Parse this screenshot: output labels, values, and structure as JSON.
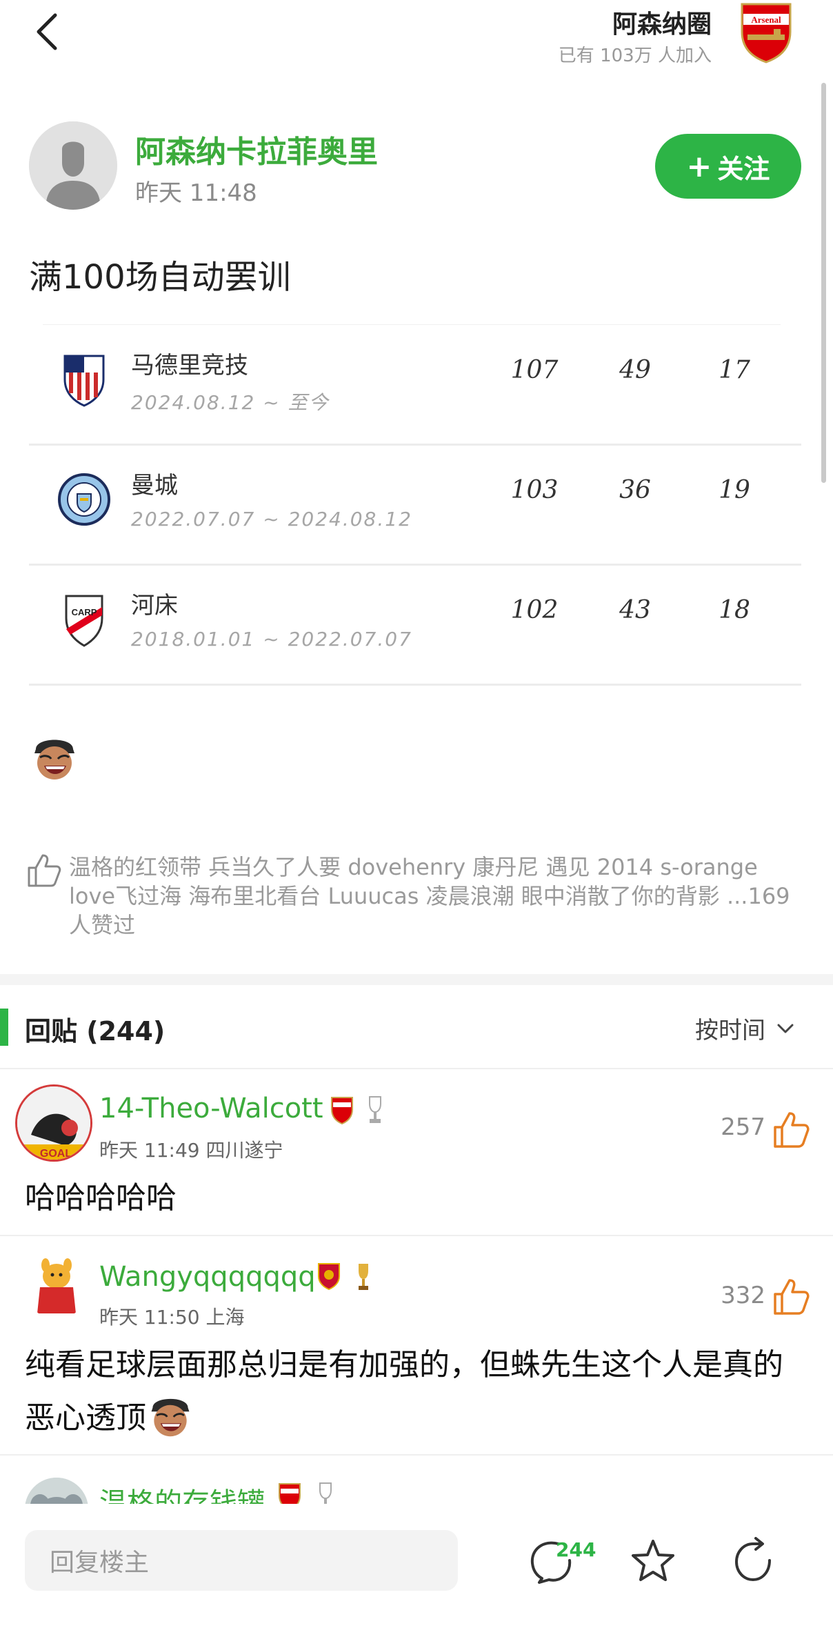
{
  "header": {
    "circle_name": "阿森纳圈",
    "members_prefix": "已有",
    "members_count": "103万",
    "members_suffix": "人加入",
    "logo_text": "Arsenal"
  },
  "post": {
    "author": "阿森纳卡拉菲奥里",
    "time": "昨天 11:48",
    "follow_label": "关注",
    "title": "满100场自动罢训"
  },
  "career": [
    {
      "club": "马德里竞技",
      "period": "2024.08.12 ~ 至今",
      "stats": [
        "107",
        "49",
        "17"
      ]
    },
    {
      "club": "曼城",
      "period": "2022.07.07 ~ 2024.08.12",
      "stats": [
        "103",
        "36",
        "19"
      ]
    },
    {
      "club": "河床",
      "period": "2018.01.01 ~ 2022.07.07",
      "stats": [
        "102",
        "43",
        "18"
      ]
    }
  ],
  "likes": {
    "text": "温格的红领带 兵当久了人要 dovehenry 康丹尼 遇见 2014 s-orange love飞过海 海布里北看台 Luuucas 凌晨浪潮 眼中消散了你的背影 ...169 人赞过"
  },
  "replies_section": {
    "title": "回贴 (244)",
    "sort_label": "按时间"
  },
  "replies": [
    {
      "name": "14-Theo-Walcott",
      "meta": "昨天 11:49 四川遂宁",
      "likes": "257",
      "text": "哈哈哈哈哈"
    },
    {
      "name": "Wangyqqqqqqq",
      "meta": "昨天 11:50 上海",
      "likes": "332",
      "text": "纯看足球层面那总归是有加强的，但蛛先生这个人是真的恶心透顶"
    },
    {
      "name": "温格的存钱罐",
      "meta": "",
      "likes": "",
      "text": ""
    }
  ],
  "bottom": {
    "reply_placeholder": "回复楼主",
    "comment_count": "244"
  },
  "colors": {
    "accent_green": "#2db446",
    "name_green": "#3cab3c",
    "arsenal_red": "#db0007"
  },
  "icons": [
    "back-arrow-icon",
    "arsenal-crest-icon",
    "thumb-up-icon",
    "chevron-down-icon",
    "comment-icon",
    "star-icon",
    "share-icon"
  ]
}
